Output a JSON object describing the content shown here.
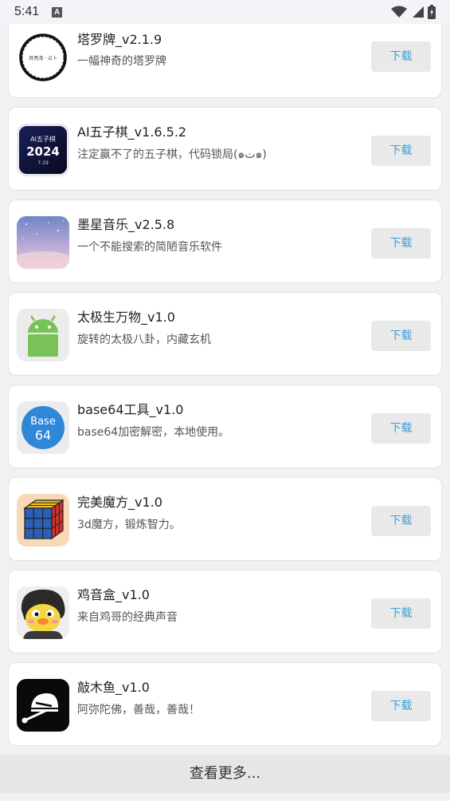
{
  "status_bar": {
    "time": "5:41",
    "icons": [
      "a-notification-icon",
      "wifi-icon",
      "signal-icon",
      "battery-icon"
    ]
  },
  "apps": [
    {
      "name": "塔罗牌_v2.1.9",
      "desc": "一幅神奇的塔罗牌",
      "icon": "tarot-icon",
      "icon_text": "月亮湾 · 占卜",
      "button": "下载"
    },
    {
      "name": "AI五子棋_v1.6.5.2",
      "desc": "注定赢不了的五子棋，代码锁局(๑ت๑)",
      "icon": "gomoku-icon",
      "icon_text_top": "AI五子棋",
      "icon_text_mid": "2024",
      "icon_text_bot": "7-19",
      "button": "下载"
    },
    {
      "name": "墨星音乐_v2.5.8",
      "desc": "一个不能搜索的简陋音乐软件",
      "icon": "starry-sky-icon",
      "button": "下载"
    },
    {
      "name": "太极生万物_v1.0",
      "desc": "旋转的太极八卦，内藏玄机",
      "icon": "android-icon",
      "button": "下载"
    },
    {
      "name": "base64工具_v1.0",
      "desc": "base64加密解密，本地使用。",
      "icon": "base64-icon",
      "icon_text_top": "Base",
      "icon_text_bot": "64",
      "button": "下载"
    },
    {
      "name": "完美魔方_v1.0",
      "desc": "3d魔方，锻炼智力。",
      "icon": "rubiks-cube-icon",
      "button": "下载"
    },
    {
      "name": "鸡音盒_v1.0",
      "desc": "来自鸡哥的经典声音",
      "icon": "cartoon-chicken-icon",
      "button": "下载"
    },
    {
      "name": "敲木鱼_v1.0",
      "desc": "阿弥陀佛，善哉，善哉！",
      "icon": "wooden-fish-icon",
      "button": "下载"
    }
  ],
  "more_label": "查看更多..."
}
